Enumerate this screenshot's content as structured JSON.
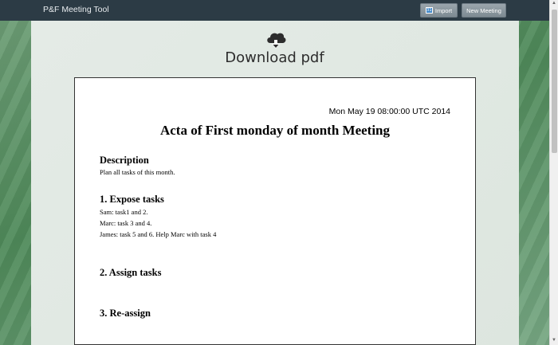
{
  "navbar": {
    "brand": "P&F Meeting Tool",
    "import_icon_text": "31",
    "import_label": "Import",
    "new_meeting_label": "New Meeting"
  },
  "download": {
    "label": "Download pdf",
    "icon": "cloud-download-icon"
  },
  "document": {
    "date": "Mon May 19 08:00:00 UTC 2014",
    "title": "Acta of First monday of month Meeting",
    "description": {
      "heading": "Description",
      "lines": [
        "Plan all tasks of this month."
      ]
    },
    "sections": [
      {
        "heading": "1. Expose tasks",
        "lines": [
          "Sam: task1 and 2.",
          "Marc: task 3 and 4.",
          "James: task 5 and 6. Help Marc with task 4"
        ]
      },
      {
        "heading": "2. Assign tasks"
      },
      {
        "heading": "3. Re-assign"
      }
    ]
  }
}
